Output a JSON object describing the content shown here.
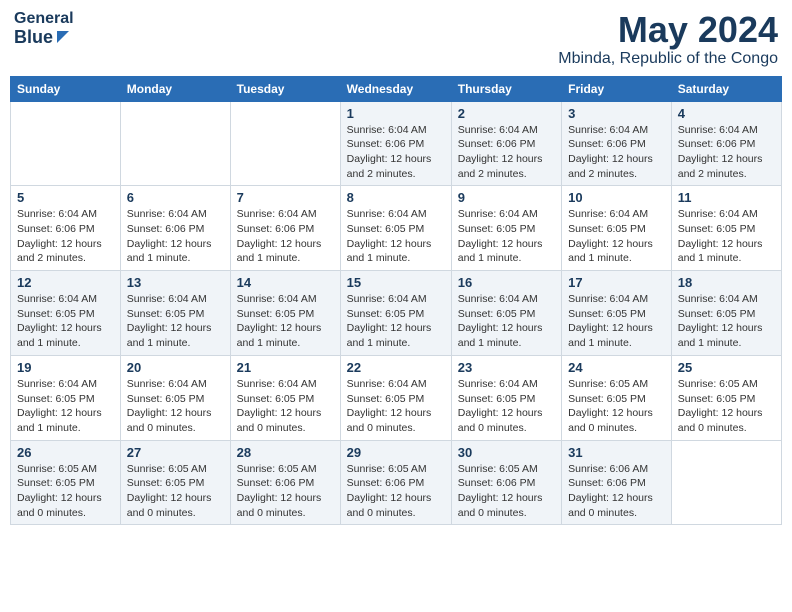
{
  "header": {
    "logo_general": "General",
    "logo_blue": "Blue",
    "title": "May 2024",
    "subtitle": "Mbinda, Republic of the Congo"
  },
  "calendar": {
    "days_of_week": [
      "Sunday",
      "Monday",
      "Tuesday",
      "Wednesday",
      "Thursday",
      "Friday",
      "Saturday"
    ],
    "weeks": [
      [
        {
          "day": "",
          "info": ""
        },
        {
          "day": "",
          "info": ""
        },
        {
          "day": "",
          "info": ""
        },
        {
          "day": "1",
          "info": "Sunrise: 6:04 AM\nSunset: 6:06 PM\nDaylight: 12 hours\nand 2 minutes."
        },
        {
          "day": "2",
          "info": "Sunrise: 6:04 AM\nSunset: 6:06 PM\nDaylight: 12 hours\nand 2 minutes."
        },
        {
          "day": "3",
          "info": "Sunrise: 6:04 AM\nSunset: 6:06 PM\nDaylight: 12 hours\nand 2 minutes."
        },
        {
          "day": "4",
          "info": "Sunrise: 6:04 AM\nSunset: 6:06 PM\nDaylight: 12 hours\nand 2 minutes."
        }
      ],
      [
        {
          "day": "5",
          "info": "Sunrise: 6:04 AM\nSunset: 6:06 PM\nDaylight: 12 hours\nand 2 minutes."
        },
        {
          "day": "6",
          "info": "Sunrise: 6:04 AM\nSunset: 6:06 PM\nDaylight: 12 hours\nand 1 minute."
        },
        {
          "day": "7",
          "info": "Sunrise: 6:04 AM\nSunset: 6:06 PM\nDaylight: 12 hours\nand 1 minute."
        },
        {
          "day": "8",
          "info": "Sunrise: 6:04 AM\nSunset: 6:05 PM\nDaylight: 12 hours\nand 1 minute."
        },
        {
          "day": "9",
          "info": "Sunrise: 6:04 AM\nSunset: 6:05 PM\nDaylight: 12 hours\nand 1 minute."
        },
        {
          "day": "10",
          "info": "Sunrise: 6:04 AM\nSunset: 6:05 PM\nDaylight: 12 hours\nand 1 minute."
        },
        {
          "day": "11",
          "info": "Sunrise: 6:04 AM\nSunset: 6:05 PM\nDaylight: 12 hours\nand 1 minute."
        }
      ],
      [
        {
          "day": "12",
          "info": "Sunrise: 6:04 AM\nSunset: 6:05 PM\nDaylight: 12 hours\nand 1 minute."
        },
        {
          "day": "13",
          "info": "Sunrise: 6:04 AM\nSunset: 6:05 PM\nDaylight: 12 hours\nand 1 minute."
        },
        {
          "day": "14",
          "info": "Sunrise: 6:04 AM\nSunset: 6:05 PM\nDaylight: 12 hours\nand 1 minute."
        },
        {
          "day": "15",
          "info": "Sunrise: 6:04 AM\nSunset: 6:05 PM\nDaylight: 12 hours\nand 1 minute."
        },
        {
          "day": "16",
          "info": "Sunrise: 6:04 AM\nSunset: 6:05 PM\nDaylight: 12 hours\nand 1 minute."
        },
        {
          "day": "17",
          "info": "Sunrise: 6:04 AM\nSunset: 6:05 PM\nDaylight: 12 hours\nand 1 minute."
        },
        {
          "day": "18",
          "info": "Sunrise: 6:04 AM\nSunset: 6:05 PM\nDaylight: 12 hours\nand 1 minute."
        }
      ],
      [
        {
          "day": "19",
          "info": "Sunrise: 6:04 AM\nSunset: 6:05 PM\nDaylight: 12 hours\nand 1 minute."
        },
        {
          "day": "20",
          "info": "Sunrise: 6:04 AM\nSunset: 6:05 PM\nDaylight: 12 hours\nand 0 minutes."
        },
        {
          "day": "21",
          "info": "Sunrise: 6:04 AM\nSunset: 6:05 PM\nDaylight: 12 hours\nand 0 minutes."
        },
        {
          "day": "22",
          "info": "Sunrise: 6:04 AM\nSunset: 6:05 PM\nDaylight: 12 hours\nand 0 minutes."
        },
        {
          "day": "23",
          "info": "Sunrise: 6:04 AM\nSunset: 6:05 PM\nDaylight: 12 hours\nand 0 minutes."
        },
        {
          "day": "24",
          "info": "Sunrise: 6:05 AM\nSunset: 6:05 PM\nDaylight: 12 hours\nand 0 minutes."
        },
        {
          "day": "25",
          "info": "Sunrise: 6:05 AM\nSunset: 6:05 PM\nDaylight: 12 hours\nand 0 minutes."
        }
      ],
      [
        {
          "day": "26",
          "info": "Sunrise: 6:05 AM\nSunset: 6:05 PM\nDaylight: 12 hours\nand 0 minutes."
        },
        {
          "day": "27",
          "info": "Sunrise: 6:05 AM\nSunset: 6:05 PM\nDaylight: 12 hours\nand 0 minutes."
        },
        {
          "day": "28",
          "info": "Sunrise: 6:05 AM\nSunset: 6:06 PM\nDaylight: 12 hours\nand 0 minutes."
        },
        {
          "day": "29",
          "info": "Sunrise: 6:05 AM\nSunset: 6:06 PM\nDaylight: 12 hours\nand 0 minutes."
        },
        {
          "day": "30",
          "info": "Sunrise: 6:05 AM\nSunset: 6:06 PM\nDaylight: 12 hours\nand 0 minutes."
        },
        {
          "day": "31",
          "info": "Sunrise: 6:06 AM\nSunset: 6:06 PM\nDaylight: 12 hours\nand 0 minutes."
        },
        {
          "day": "",
          "info": ""
        }
      ]
    ]
  }
}
